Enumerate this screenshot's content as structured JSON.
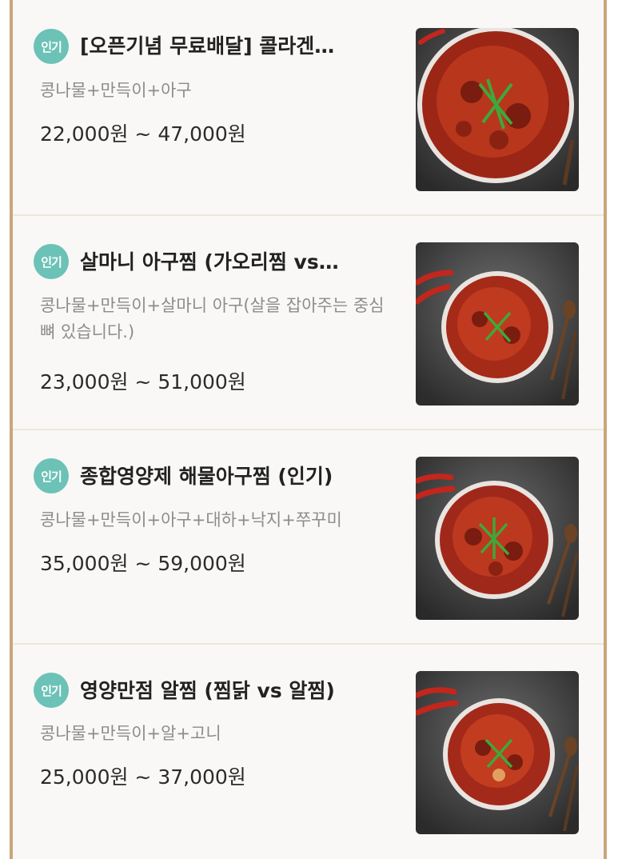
{
  "menu": {
    "items": [
      {
        "badge": "인기",
        "title": "[오픈기념 무료배달] 콜라겐…",
        "description": "콩나물+만득이+아구",
        "price": "22,000원 ~ 47,000원",
        "image_icon": "braised-monkfish-dish-image"
      },
      {
        "badge": "인기",
        "title": "살마니 아구찜 (가오리찜 vs…",
        "description": "콩나물+만득이+살마니 아구(살을 잡아주는 중심 뼈 있습니다.)",
        "price": "23,000원 ~ 51,000원",
        "image_icon": "braised-monkfish-dish-image"
      },
      {
        "badge": "인기",
        "title": "종합영양제 해물아구찜 (인기)",
        "description": "콩나물+만득이+아구+대하+낙지+쭈꾸미",
        "price": "35,000원 ~ 59,000원",
        "image_icon": "braised-seafood-dish-image"
      },
      {
        "badge": "인기",
        "title": "영양만점 알찜 (찜닭 vs 알찜)",
        "description": "콩나물+만득이+알+고니",
        "price": "25,000원 ~ 37,000원",
        "image_icon": "braised-roe-dish-image"
      }
    ]
  },
  "colors": {
    "badge": "#6cc2b6",
    "frame": "#c9a679",
    "title": "#222222",
    "description": "#8c8c8c",
    "price": "#2b2b2b"
  }
}
